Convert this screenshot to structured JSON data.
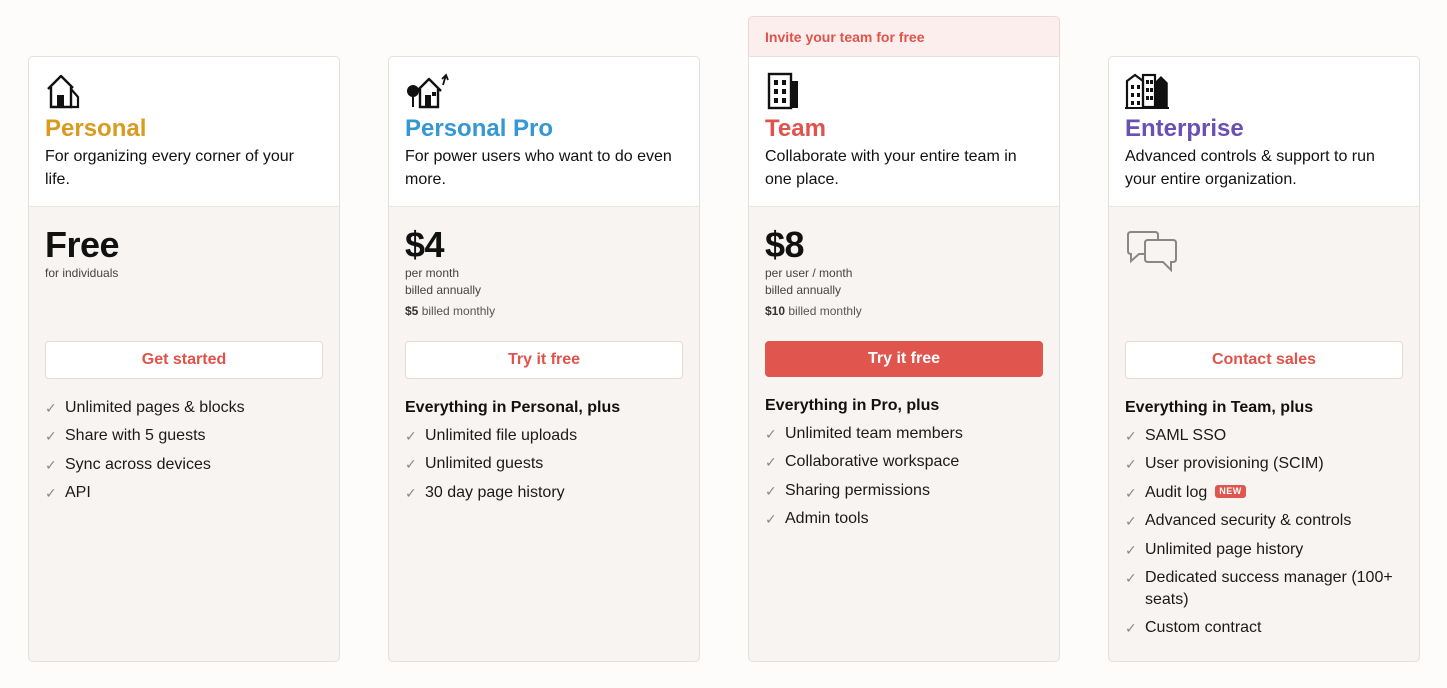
{
  "invite_banner": "Invite your team for free",
  "colors": {
    "personal": "#d99b1f",
    "personal_pro": "#3597d4",
    "team": "#e0534a",
    "enterprise": "#6a4fb5",
    "accent": "#e0564e"
  },
  "plans": [
    {
      "name": "Personal",
      "icon": "house-icon",
      "description": "For organizing every corner of your life.",
      "price": "Free",
      "price_sub": "for individuals",
      "cta": "Get started",
      "features": [
        "Unlimited pages & blocks",
        "Share with 5 guests",
        "Sync across devices",
        "API"
      ]
    },
    {
      "name": "Personal Pro",
      "icon": "house-with-tree-icon",
      "description": "For power users who want to do even more.",
      "price": "$4",
      "price_sub_1": "per month",
      "price_sub_2": "billed annually",
      "monthly_price": "$5",
      "monthly_label": "billed monthly",
      "cta": "Try it free",
      "features_head": "Everything in Personal, plus",
      "features": [
        "Unlimited file uploads",
        "Unlimited guests",
        "30 day page history"
      ]
    },
    {
      "name": "Team",
      "icon": "office-building-icon",
      "description": "Collaborate with your entire team in one place.",
      "price": "$8",
      "price_sub_1": "per user / month",
      "price_sub_2": "billed annually",
      "monthly_price": "$10",
      "monthly_label": "billed monthly",
      "cta": "Try it free",
      "features_head": "Everything in Pro, plus",
      "features": [
        "Unlimited team members",
        "Collaborative workspace",
        "Sharing permissions",
        "Admin tools"
      ]
    },
    {
      "name": "Enterprise",
      "icon": "city-buildings-icon",
      "description": "Advanced controls & support to run your entire organization.",
      "price_icon": "chat-bubbles-icon",
      "cta": "Contact sales",
      "features_head": "Everything in Team, plus",
      "features": [
        "SAML SSO",
        "User provisioning (SCIM)",
        "Audit log",
        "Advanced security & controls",
        "Unlimited page history",
        "Dedicated success manager (100+ seats)",
        "Custom contract"
      ],
      "new_badge": "NEW"
    }
  ]
}
